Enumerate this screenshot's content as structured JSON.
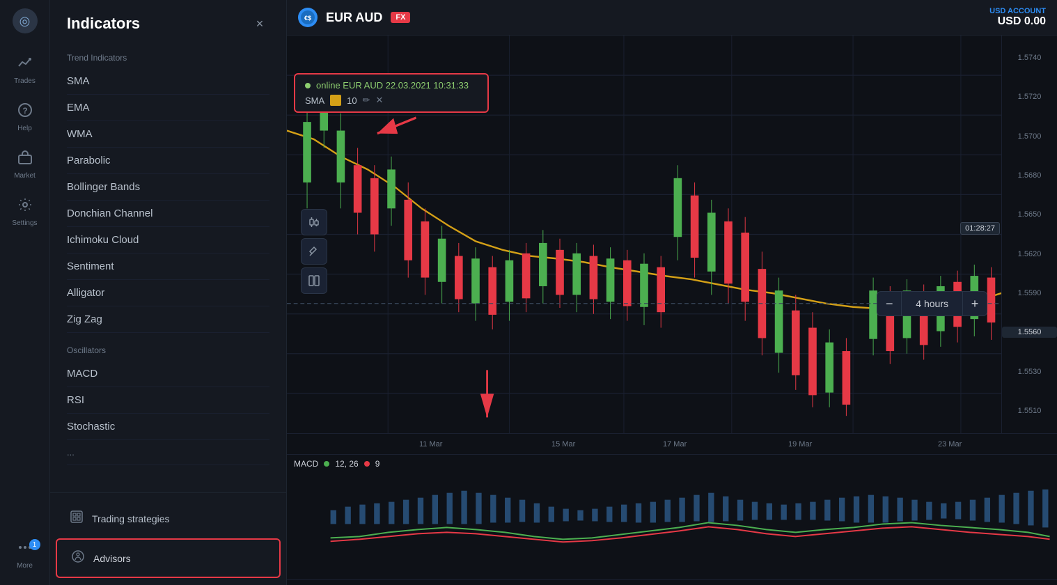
{
  "nav": {
    "logo": "◎",
    "items": [
      {
        "id": "trades",
        "label": "Trades",
        "icon": "📈"
      },
      {
        "id": "help",
        "label": "Help",
        "icon": "❓"
      },
      {
        "id": "market",
        "label": "Market",
        "icon": "🛒"
      },
      {
        "id": "settings",
        "label": "Settings",
        "icon": "⚙"
      },
      {
        "id": "more",
        "label": "More",
        "icon": "···",
        "badge": "1"
      }
    ]
  },
  "indicators_panel": {
    "title": "Indicators",
    "close_btn": "×",
    "trend_section": "Trend Indicators",
    "trend_items": [
      "SMA",
      "EMA",
      "WMA",
      "Parabolic",
      "Bollinger Bands",
      "Donchian Channel",
      "Ichimoku Cloud",
      "Sentiment",
      "Alligator",
      "Zig Zag"
    ],
    "oscillators_section": "Oscillators",
    "oscillator_items": [
      "MACD",
      "RSI",
      "Stochastic"
    ],
    "bottom_buttons": [
      {
        "id": "trading-strategies",
        "label": "Trading strategies",
        "icon": "▣"
      },
      {
        "id": "advisors",
        "label": "Advisors",
        "icon": "💡",
        "highlighted": true
      }
    ]
  },
  "chart": {
    "symbol": "EUR AUD",
    "symbol_icon": "💱",
    "fx_badge": "FX",
    "sma_info": {
      "status": "online EUR AUD 22.03.2021 10:31:33",
      "status_color": "#8dce6f",
      "label": "SMA",
      "value": "10",
      "color": "#d4a017"
    },
    "time_indicator": "01:28:27",
    "timeframe": "4 hours",
    "date_labels": [
      {
        "label": "11 Mar",
        "pos": 220
      },
      {
        "label": "15 Mar",
        "pos": 420
      },
      {
        "label": "17 Mar",
        "pos": 570
      },
      {
        "label": "19 Mar",
        "pos": 750
      },
      {
        "label": "23 Mar",
        "pos": 960
      }
    ],
    "macd_label": "MACD",
    "macd_legend": [
      {
        "label": "12, 26",
        "color": "#4caf50"
      },
      {
        "label": "9",
        "color": "#e63946"
      }
    ],
    "price_labels": [
      "1.5740",
      "1.5720",
      "1.5700",
      "1.5680",
      "1.5650",
      "1.5620",
      "1.5590",
      "1.5560",
      "1.5530",
      "1.5510"
    ],
    "current_price": "01:28:27"
  },
  "account": {
    "label": "USD ACCOUNT",
    "value": "USD 0.00"
  }
}
